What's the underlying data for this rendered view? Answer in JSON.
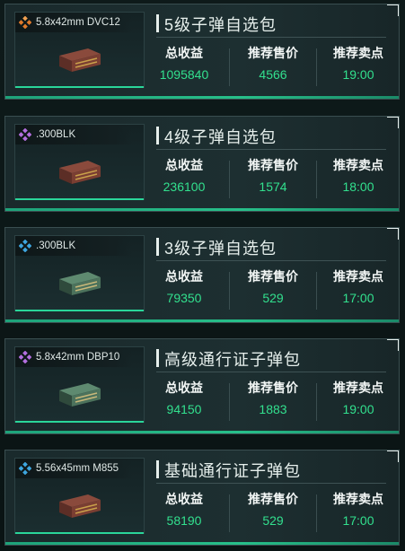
{
  "labels": {
    "total_profit": "总收益",
    "recommended_price": "推荐售价",
    "recommended_sell_point": "推荐卖点"
  },
  "colors": {
    "gold": "#e07a2a",
    "purple": "#b46fe0",
    "blue": "#3ea6e0",
    "value_green": "#32e08e",
    "accent_bar": "#27c08a"
  },
  "cards": [
    {
      "caliber": "5.8x42mm DVC12",
      "rarity_icon": "gold-rarity-icon",
      "rarity_color": "#e07a2a",
      "box_color": "red",
      "title": "5级子弹自选包",
      "total_profit": "1095840",
      "recommended_price": "4566",
      "recommended_sell_point": "19:00"
    },
    {
      "caliber": ".300BLK",
      "rarity_icon": "purple-rarity-icon",
      "rarity_color": "#b46fe0",
      "box_color": "red",
      "title": "4级子弹自选包",
      "total_profit": "236100",
      "recommended_price": "1574",
      "recommended_sell_point": "18:00"
    },
    {
      "caliber": ".300BLK",
      "rarity_icon": "blue-rarity-icon",
      "rarity_color": "#3ea6e0",
      "box_color": "green",
      "title": "3级子弹自选包",
      "total_profit": "79350",
      "recommended_price": "529",
      "recommended_sell_point": "17:00"
    },
    {
      "caliber": "5.8x42mm DBP10",
      "rarity_icon": "purple-rarity-icon",
      "rarity_color": "#b46fe0",
      "box_color": "green",
      "title": "高级通行证子弹包",
      "total_profit": "94150",
      "recommended_price": "1883",
      "recommended_sell_point": "19:00"
    },
    {
      "caliber": "5.56x45mm M855",
      "rarity_icon": "blue-rarity-icon",
      "rarity_color": "#3ea6e0",
      "box_color": "red",
      "title": "基础通行证子弹包",
      "total_profit": "58190",
      "recommended_price": "529",
      "recommended_sell_point": "17:00"
    }
  ]
}
